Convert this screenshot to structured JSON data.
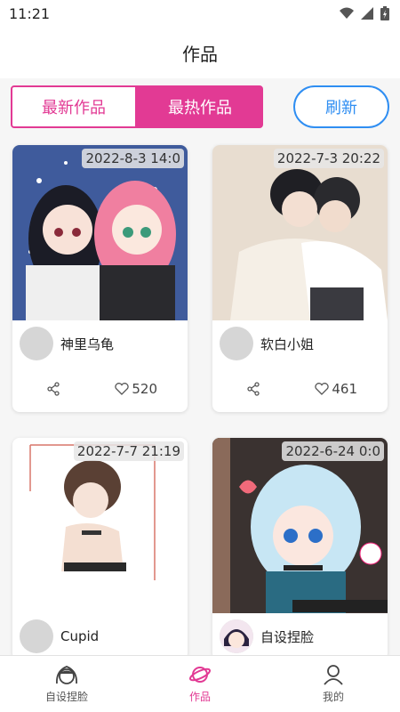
{
  "status": {
    "time": "11:21"
  },
  "header": {
    "title": "作品"
  },
  "tabs": {
    "latest_label": "最新作品",
    "hot_label": "最热作品",
    "refresh_label": "刷新"
  },
  "works": [
    {
      "date": "2022-8-3 14:0",
      "author": "神里乌龟",
      "likes": "520"
    },
    {
      "date": "2022-7-3 20:22",
      "author": "软白小姐",
      "likes": "461"
    },
    {
      "date": "2022-7-7 21:19",
      "author": "Cupid"
    },
    {
      "date": "2022-6-24 0:0",
      "author": "自设捏脸"
    }
  ],
  "nav": {
    "custom_label": "自设捏脸",
    "works_label": "作品",
    "mine_label": "我的"
  },
  "colors": {
    "accent": "#e23a94",
    "refresh": "#2f8ef2"
  }
}
